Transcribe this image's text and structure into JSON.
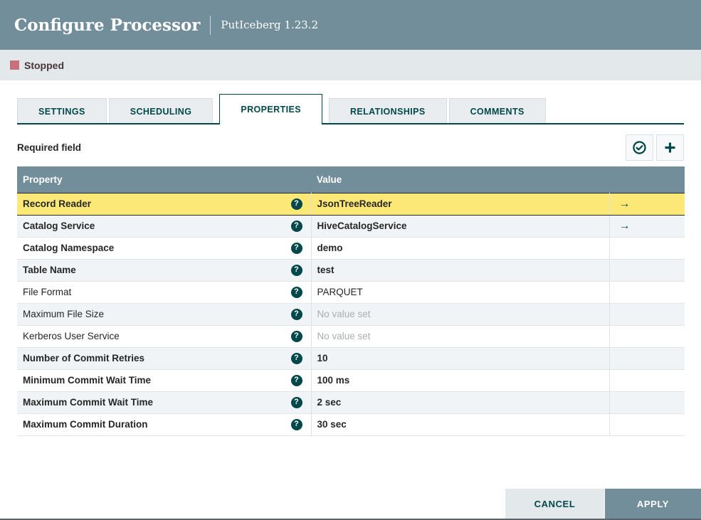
{
  "header": {
    "title": "Configure Processor",
    "subtitle": "PutIceberg 1.23.2"
  },
  "status_bar": {
    "label": "Stopped",
    "indicator_color": "#c7717a"
  },
  "tabs": [
    {
      "label": "SETTINGS",
      "active": false
    },
    {
      "label": "SCHEDULING",
      "active": false
    },
    {
      "label": "PROPERTIES",
      "active": true
    },
    {
      "label": "RELATIONSHIPS",
      "active": false
    },
    {
      "label": "COMMENTS",
      "active": false
    }
  ],
  "properties_tab": {
    "required_field_label": "Required field",
    "toolbar_buttons": [
      {
        "name": "verify-properties-button",
        "icon": "check-circle-icon"
      },
      {
        "name": "add-property-button",
        "icon": "plus-icon"
      }
    ],
    "table": {
      "columns": [
        "Property",
        "Value"
      ],
      "help_icon_glyph": "?",
      "goto_arrow_glyph": "→",
      "rows": [
        {
          "property": "Record Reader",
          "value": "JsonTreeReader",
          "required": true,
          "value_set": true,
          "selected": true,
          "goto_arrow": true
        },
        {
          "property": "Catalog Service",
          "value": "HiveCatalogService",
          "required": true,
          "value_set": true,
          "selected": false,
          "goto_arrow": true
        },
        {
          "property": "Catalog Namespace",
          "value": "demo",
          "required": true,
          "value_set": true,
          "selected": false,
          "goto_arrow": false
        },
        {
          "property": "Table Name",
          "value": "test",
          "required": true,
          "value_set": true,
          "selected": false,
          "goto_arrow": false
        },
        {
          "property": "File Format",
          "value": "PARQUET",
          "required": false,
          "value_set": true,
          "selected": false,
          "goto_arrow": false
        },
        {
          "property": "Maximum File Size",
          "value": "No value set",
          "required": false,
          "value_set": false,
          "selected": false,
          "goto_arrow": false
        },
        {
          "property": "Kerberos User Service",
          "value": "No value set",
          "required": false,
          "value_set": false,
          "selected": false,
          "goto_arrow": false
        },
        {
          "property": "Number of Commit Retries",
          "value": "10",
          "required": true,
          "value_set": true,
          "selected": false,
          "goto_arrow": false
        },
        {
          "property": "Minimum Commit Wait Time",
          "value": "100 ms",
          "required": true,
          "value_set": true,
          "selected": false,
          "goto_arrow": false
        },
        {
          "property": "Maximum Commit Wait Time",
          "value": "2 sec",
          "required": true,
          "value_set": true,
          "selected": false,
          "goto_arrow": false
        },
        {
          "property": "Maximum Commit Duration",
          "value": "30 sec",
          "required": true,
          "value_set": true,
          "selected": false,
          "goto_arrow": false
        }
      ]
    }
  },
  "footer": {
    "cancel_label": "CANCEL",
    "apply_label": "APPLY"
  },
  "colors": {
    "header_bg": "#728e9b",
    "accent_teal": "#004849",
    "status_bar_bg": "#e3e8ea",
    "stopped_indicator": "#c7717a",
    "selected_row_bg": "#fbe877",
    "alt_row_bg": "#f1f4f6",
    "unset_value_text": "#a9aeb1"
  }
}
